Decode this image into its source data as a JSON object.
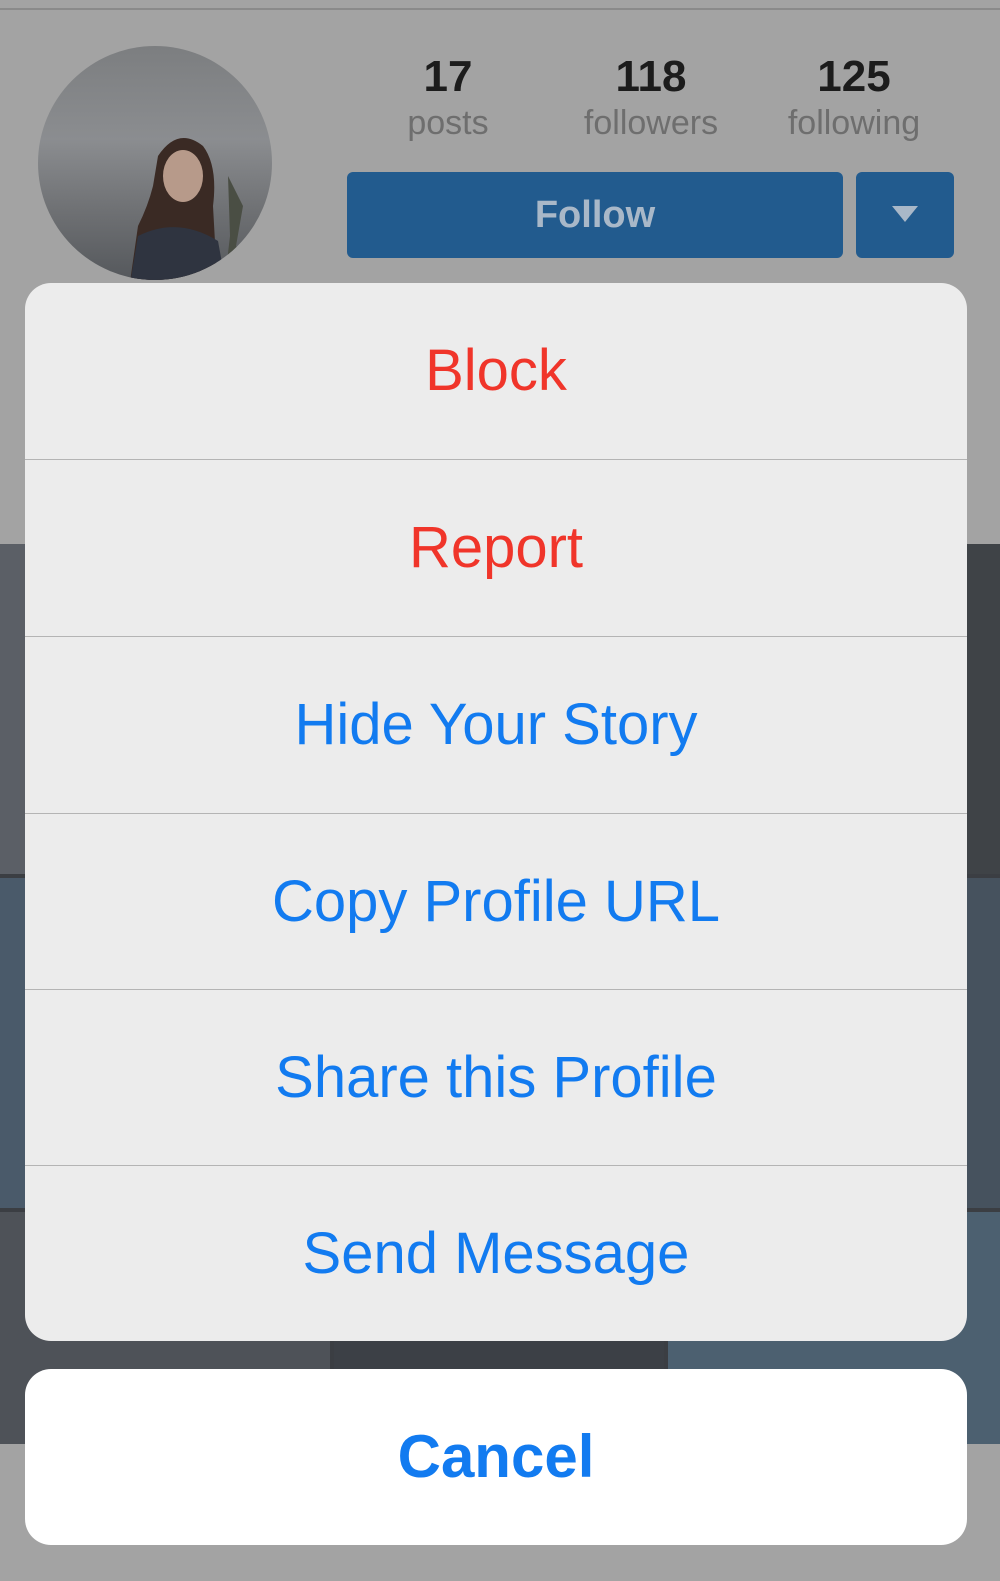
{
  "profile": {
    "stats": [
      {
        "count": "17",
        "label": "posts"
      },
      {
        "count": "118",
        "label": "followers"
      },
      {
        "count": "125",
        "label": "following"
      }
    ],
    "follow_label": "Follow",
    "avatar_icon": "avatar-photo",
    "dropdown_icon": "triangle-down-icon"
  },
  "action_sheet": {
    "items": [
      {
        "label": "Block",
        "style": "destructive"
      },
      {
        "label": "Report",
        "style": "destructive"
      },
      {
        "label": "Hide Your Story",
        "style": "default"
      },
      {
        "label": "Copy Profile URL",
        "style": "default"
      },
      {
        "label": "Share this Profile",
        "style": "default"
      },
      {
        "label": "Send Message",
        "style": "default"
      }
    ],
    "cancel_label": "Cancel"
  },
  "colors": {
    "destructive": "#f0352a",
    "action_blue": "#127bf0",
    "follow_button": "#225b8e",
    "sheet_background": "#ececec",
    "dim_overlay": "#a3a3a3"
  }
}
